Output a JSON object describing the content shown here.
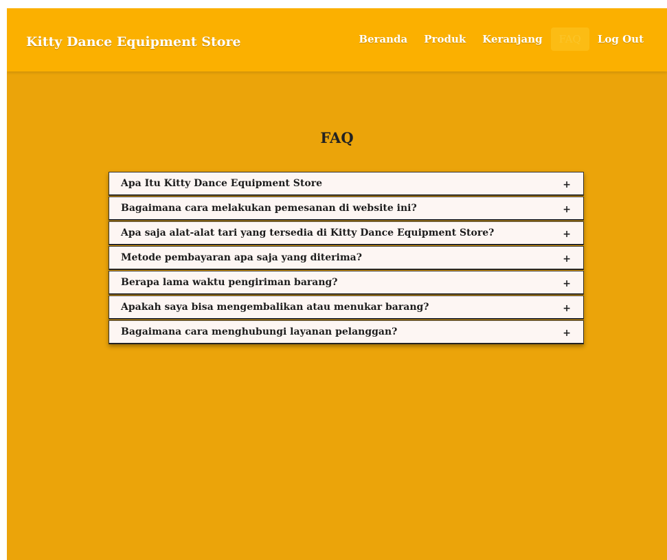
{
  "navbar": {
    "brand": "Kitty Dance Equipment Store",
    "links": [
      {
        "label": "Beranda",
        "active": false
      },
      {
        "label": "Produk",
        "active": false
      },
      {
        "label": "Keranjang",
        "active": false
      },
      {
        "label": "FAQ",
        "active": true
      },
      {
        "label": "Log Out",
        "active": false
      }
    ]
  },
  "main": {
    "title": "FAQ",
    "faq_items": [
      {
        "question": "Apa Itu Kitty Dance Equipment Store",
        "toggle": "+"
      },
      {
        "question": "Bagaimana cara melakukan pemesanan di website ini?",
        "toggle": "+"
      },
      {
        "question": "Apa saja alat-alat tari yang tersedia di Kitty Dance Equipment Store?",
        "toggle": "+"
      },
      {
        "question": "Metode pembayaran apa saja yang diterima?",
        "toggle": "+"
      },
      {
        "question": "Berapa lama waktu pengiriman barang?",
        "toggle": "+"
      },
      {
        "question": "Apakah saya bisa mengembalikan atau menukar barang?",
        "toggle": "+"
      },
      {
        "question": "Bagaimana cara menghubungi layanan pelanggan?",
        "toggle": "+"
      }
    ]
  },
  "colors": {
    "navbar_bg": "#fbb000",
    "page_bg": "#eba40a",
    "faq_item_bg": "#fdf6f3",
    "text_dark": "#1c1c1c"
  }
}
